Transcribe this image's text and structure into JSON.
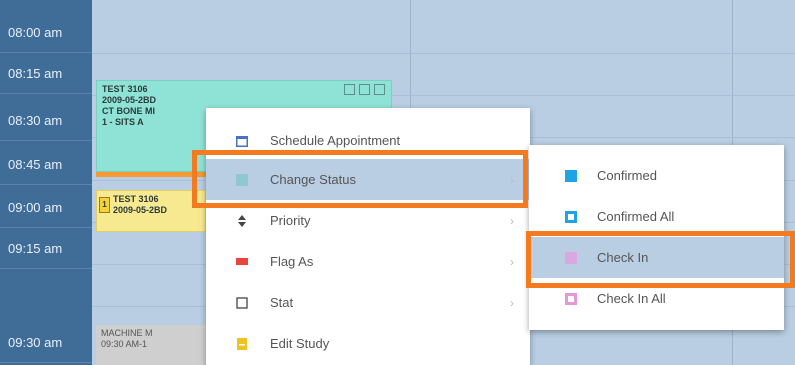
{
  "time_slots": [
    "08:00 am",
    "08:15 am",
    "08:30 am",
    "08:45 am",
    "09:00 am",
    "09:15 am",
    "09:30 am"
  ],
  "appointments": [
    {
      "lines": [
        "TEST 3106",
        "2009-05-2BD",
        "CT BONE MI",
        "1 - SITS A"
      ]
    },
    {
      "badge": "1",
      "lines": [
        "TEST 3106",
        "2009-05-2BD"
      ]
    },
    {
      "lines": [
        "MACHINE M",
        "09:30 AM-1"
      ]
    }
  ],
  "context_menu": {
    "items": [
      {
        "label": "Schedule Appointment",
        "icon": "calendar-icon",
        "has_submenu": false
      },
      {
        "label": "Change Status",
        "icon": "status-icon",
        "has_submenu": true
      },
      {
        "label": "Priority",
        "icon": "priority-icon",
        "has_submenu": true
      },
      {
        "label": "Flag As",
        "icon": "flag-icon",
        "has_submenu": true
      },
      {
        "label": "Stat",
        "icon": "checkbox-icon",
        "has_submenu": true
      },
      {
        "label": "Edit Study",
        "icon": "edit-study-icon",
        "has_submenu": false
      }
    ],
    "submenu_arrow": "›"
  },
  "status_submenu": {
    "items": [
      {
        "label": "Confirmed",
        "icon": "confirmed-icon",
        "color": "#1fa3e6"
      },
      {
        "label": "Confirmed All",
        "icon": "confirmed-all-icon",
        "color": "#1fa3e6"
      },
      {
        "label": "Check In",
        "icon": "check-in-icon",
        "color": "#d9a8e0"
      },
      {
        "label": "Check In All",
        "icon": "check-in-all-icon",
        "color": "#e49ad8"
      }
    ]
  },
  "colors": {
    "highlight_frame": "#f47a20",
    "time_column": "#3f6d98",
    "hover_row": "#b9cee3",
    "flag": "#e8453c"
  }
}
